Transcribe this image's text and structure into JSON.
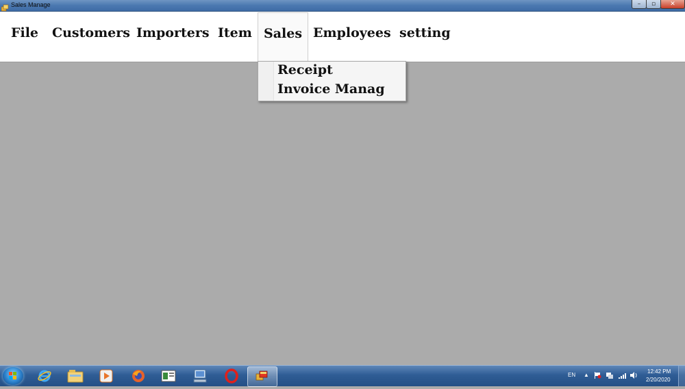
{
  "window": {
    "title": "Sales Manage",
    "controls": {
      "minimize": "–",
      "maximize": "▫",
      "close": "✕"
    }
  },
  "menubar": {
    "items": [
      {
        "label": "File"
      },
      {
        "label": "Customers"
      },
      {
        "label": "Importers"
      },
      {
        "label": "Item"
      },
      {
        "label": "Sales"
      },
      {
        "label": "Employees"
      },
      {
        "label": "setting"
      }
    ],
    "open_menu": "Sales"
  },
  "dropdown": {
    "items": [
      {
        "label": "Receipt"
      },
      {
        "label": "Invoice Manag"
      }
    ]
  },
  "taskbar": {
    "apps": [
      "internet-explorer-icon",
      "file-explorer-icon",
      "media-player-icon",
      "firefox-icon",
      "window-app-icon",
      "computer-icon",
      "opera-icon",
      "sales-app-icon"
    ],
    "tray": {
      "language": "EN",
      "time": "12:42 PM",
      "date": "2/20/2020"
    }
  },
  "colors": {
    "workspace": "#ababab",
    "menubar": "#ffffff",
    "titlebar": "#4b78b0",
    "taskbar": "#2f5d95"
  }
}
